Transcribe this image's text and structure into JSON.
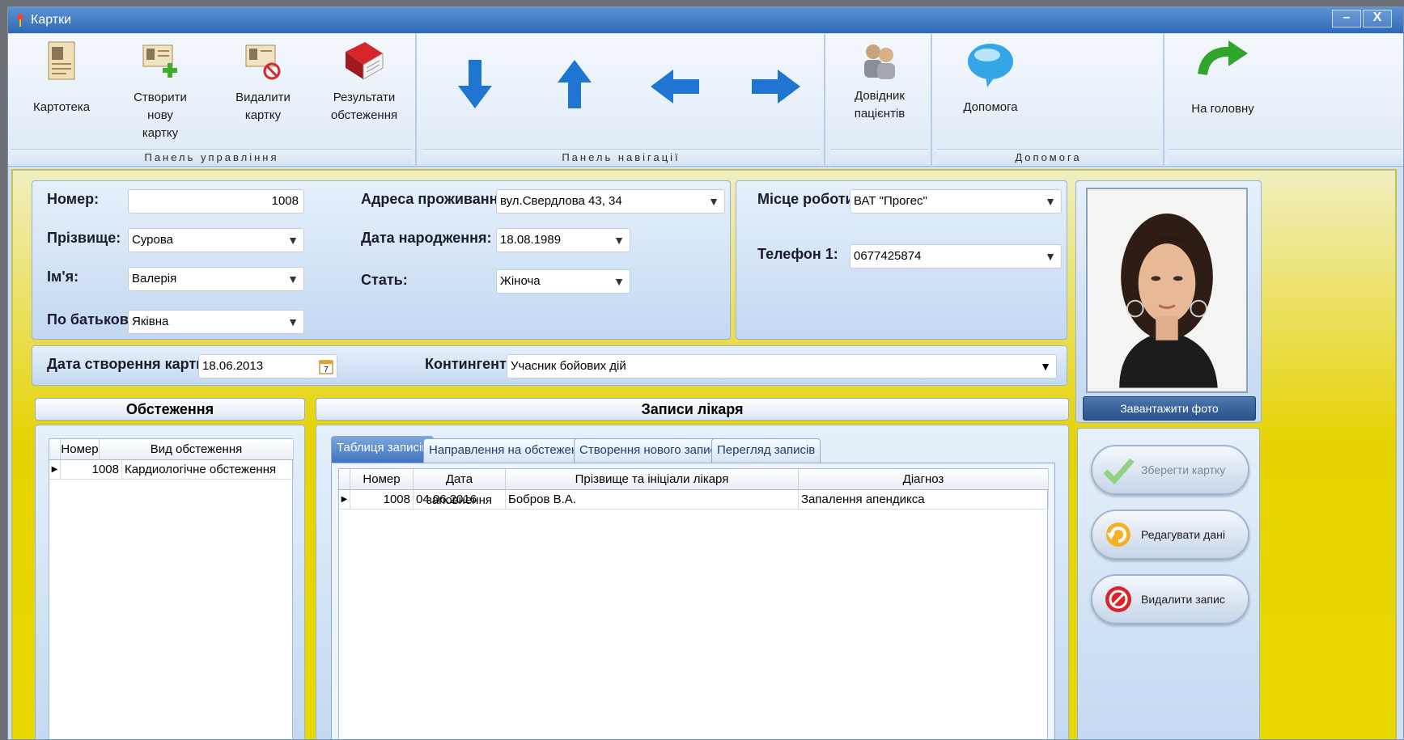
{
  "window": {
    "title": "Картки",
    "min_label": "–",
    "close_label": "X"
  },
  "ribbon": {
    "groups": [
      {
        "label": "Панель управління"
      },
      {
        "label": "Панель навігації"
      },
      {
        "label": ""
      },
      {
        "label": "Допомога"
      },
      {
        "label": ""
      }
    ],
    "buttons": {
      "cards": "Картотека",
      "new_card_1": "Створити нову",
      "new_card_2": "картку",
      "delete_card_1": "Видалити",
      "delete_card_2": "картку",
      "results_1": "Результати",
      "results_2": "обстеження",
      "patients_1": "Довідник",
      "patients_2": "пацієнтів",
      "help": "Допомога",
      "home": "На головну"
    },
    "nav_icons": [
      "arrow-down-icon",
      "arrow-up-icon",
      "arrow-left-icon",
      "arrow-right-icon"
    ]
  },
  "form": {
    "number_label": "Номер:",
    "number_value": "1008",
    "surname_label": "Прізвище:",
    "surname_value": "Сурова",
    "name_label": "Ім'я:",
    "name_value": "Валерія",
    "patronymic_label": "По батькові:",
    "patronymic_value": "Яківна",
    "address_label": "Адреса проживання:",
    "address_value": "вул.Свердлова 43, 34",
    "birth_label": "Дата народження:",
    "birth_value": "18.08.1989",
    "sex_label": "Стать:",
    "sex_value": "Жіноча",
    "work_label": "Місце роботи:",
    "work_value": "ВАТ \"Прогес\"",
    "phone_label": "Телефон 1:",
    "phone_value": "0677425874",
    "created_label": "Дата створення картки:",
    "created_value": "18.06.2013",
    "contingent_label": "Контингент:",
    "contingent_value": "Учасник бойових дій"
  },
  "photo": {
    "upload_label": "Завантажити фото"
  },
  "exams": {
    "header": "Обстеження",
    "columns": [
      "Номер",
      "Вид обстеження"
    ],
    "rows": [
      {
        "number": "1008",
        "type": "Кардиологічне обстеження"
      }
    ]
  },
  "records": {
    "header": "Записи лікаря",
    "tabs": [
      "Таблиця записів",
      "Направлення на обстеження",
      "Створення нового запису",
      "Перегляд записів"
    ],
    "columns": [
      "Номер",
      "Дата заповнення",
      "Прізвище та ініціали лікаря",
      "Діагноз"
    ],
    "rows": [
      {
        "number": "1008",
        "date": "04.06.2016",
        "doctor": "Бобров В.А.",
        "diagnosis": "Запалення апендикса"
      }
    ]
  },
  "actions": {
    "save": "Зберегти картку",
    "edit": "Редагувати дані",
    "delete": "Видалити запис"
  }
}
